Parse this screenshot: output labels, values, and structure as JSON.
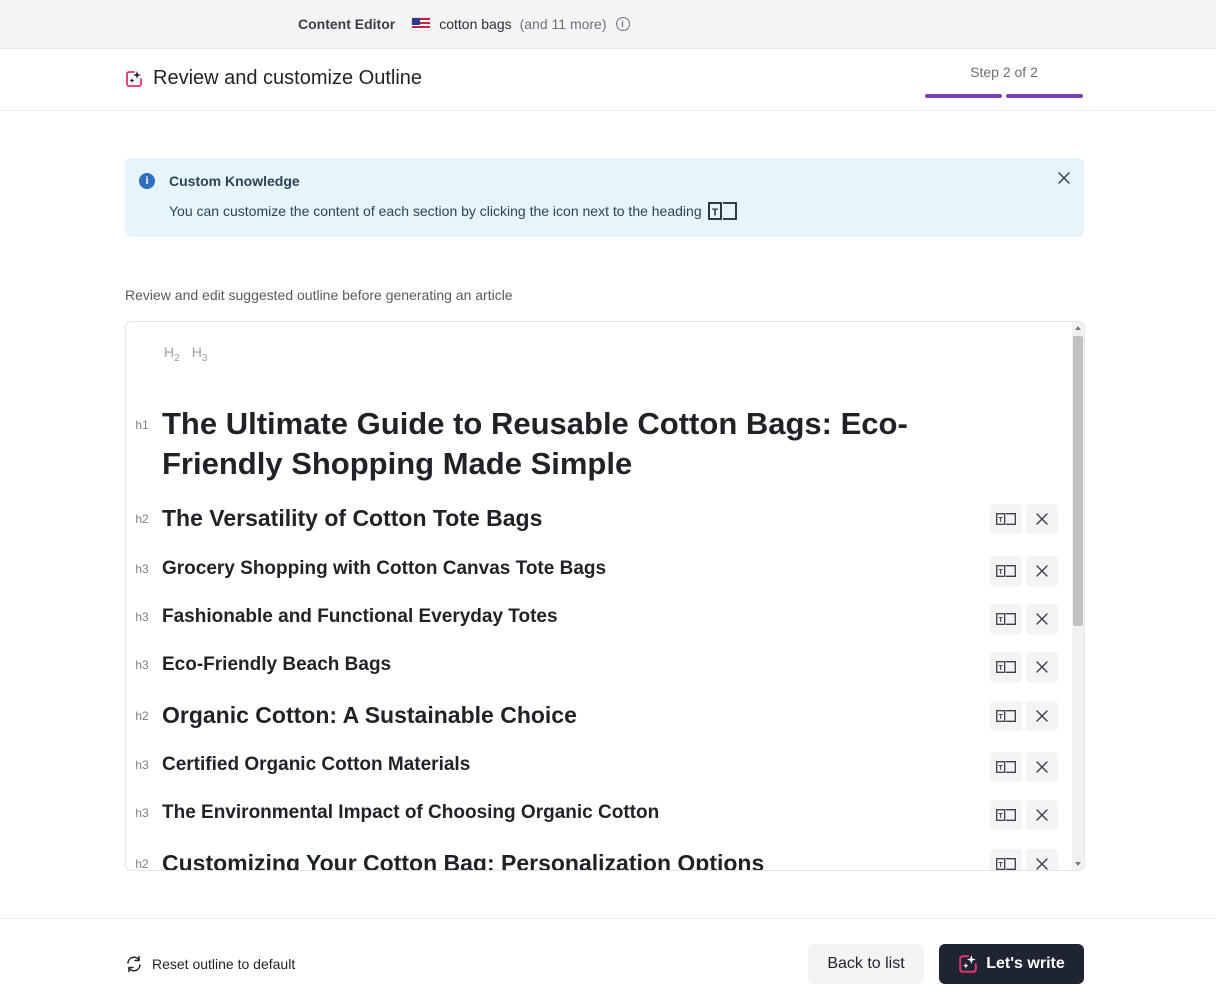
{
  "topbar": {
    "app_name": "Content Editor",
    "flag_icon": "us-flag-icon",
    "keyword": "cotton bags",
    "more": "(and 11 more)",
    "info_icon": "info-icon"
  },
  "header": {
    "title": "Review and customize Outline",
    "step": "Step 2 of 2",
    "steps_total": 2,
    "steps_completed": 2,
    "accent_color": "#7e3fb8"
  },
  "alert": {
    "title": "Custom Knowledge",
    "text": "You can customize the content of each section by clicking the icon next to the heading",
    "background": "#e6f4fc"
  },
  "hint": "Review and edit suggested outline before generating an article",
  "editor": {
    "toolbar": {
      "h2_main": "H",
      "h2_sub": "2",
      "h3_main": "H",
      "h3_sub": "3"
    },
    "rows": [
      {
        "level": "h1",
        "text": "The Ultimate Guide to Reusable Cotton Bags: Eco-Friendly Shopping Made Simple"
      },
      {
        "level": "h2",
        "text": "The Versatility of Cotton Tote Bags"
      },
      {
        "level": "h3",
        "text": "Grocery Shopping with Cotton Canvas Tote Bags"
      },
      {
        "level": "h3",
        "text": "Fashionable and Functional Everyday Totes"
      },
      {
        "level": "h3",
        "text": "Eco-Friendly Beach Bags"
      },
      {
        "level": "h2",
        "text": "Organic Cotton: A Sustainable Choice"
      },
      {
        "level": "h3",
        "text": "Certified Organic Cotton Materials"
      },
      {
        "level": "h3",
        "text": "The Environmental Impact of Choosing Organic Cotton"
      },
      {
        "level": "h2",
        "text": "Customizing Your Cotton Bag: Personalization Options"
      }
    ]
  },
  "footer": {
    "reset_label": "Reset outline to default",
    "back_label": "Back to list",
    "write_label": "Let's write",
    "write_bg": "#1f2433"
  }
}
